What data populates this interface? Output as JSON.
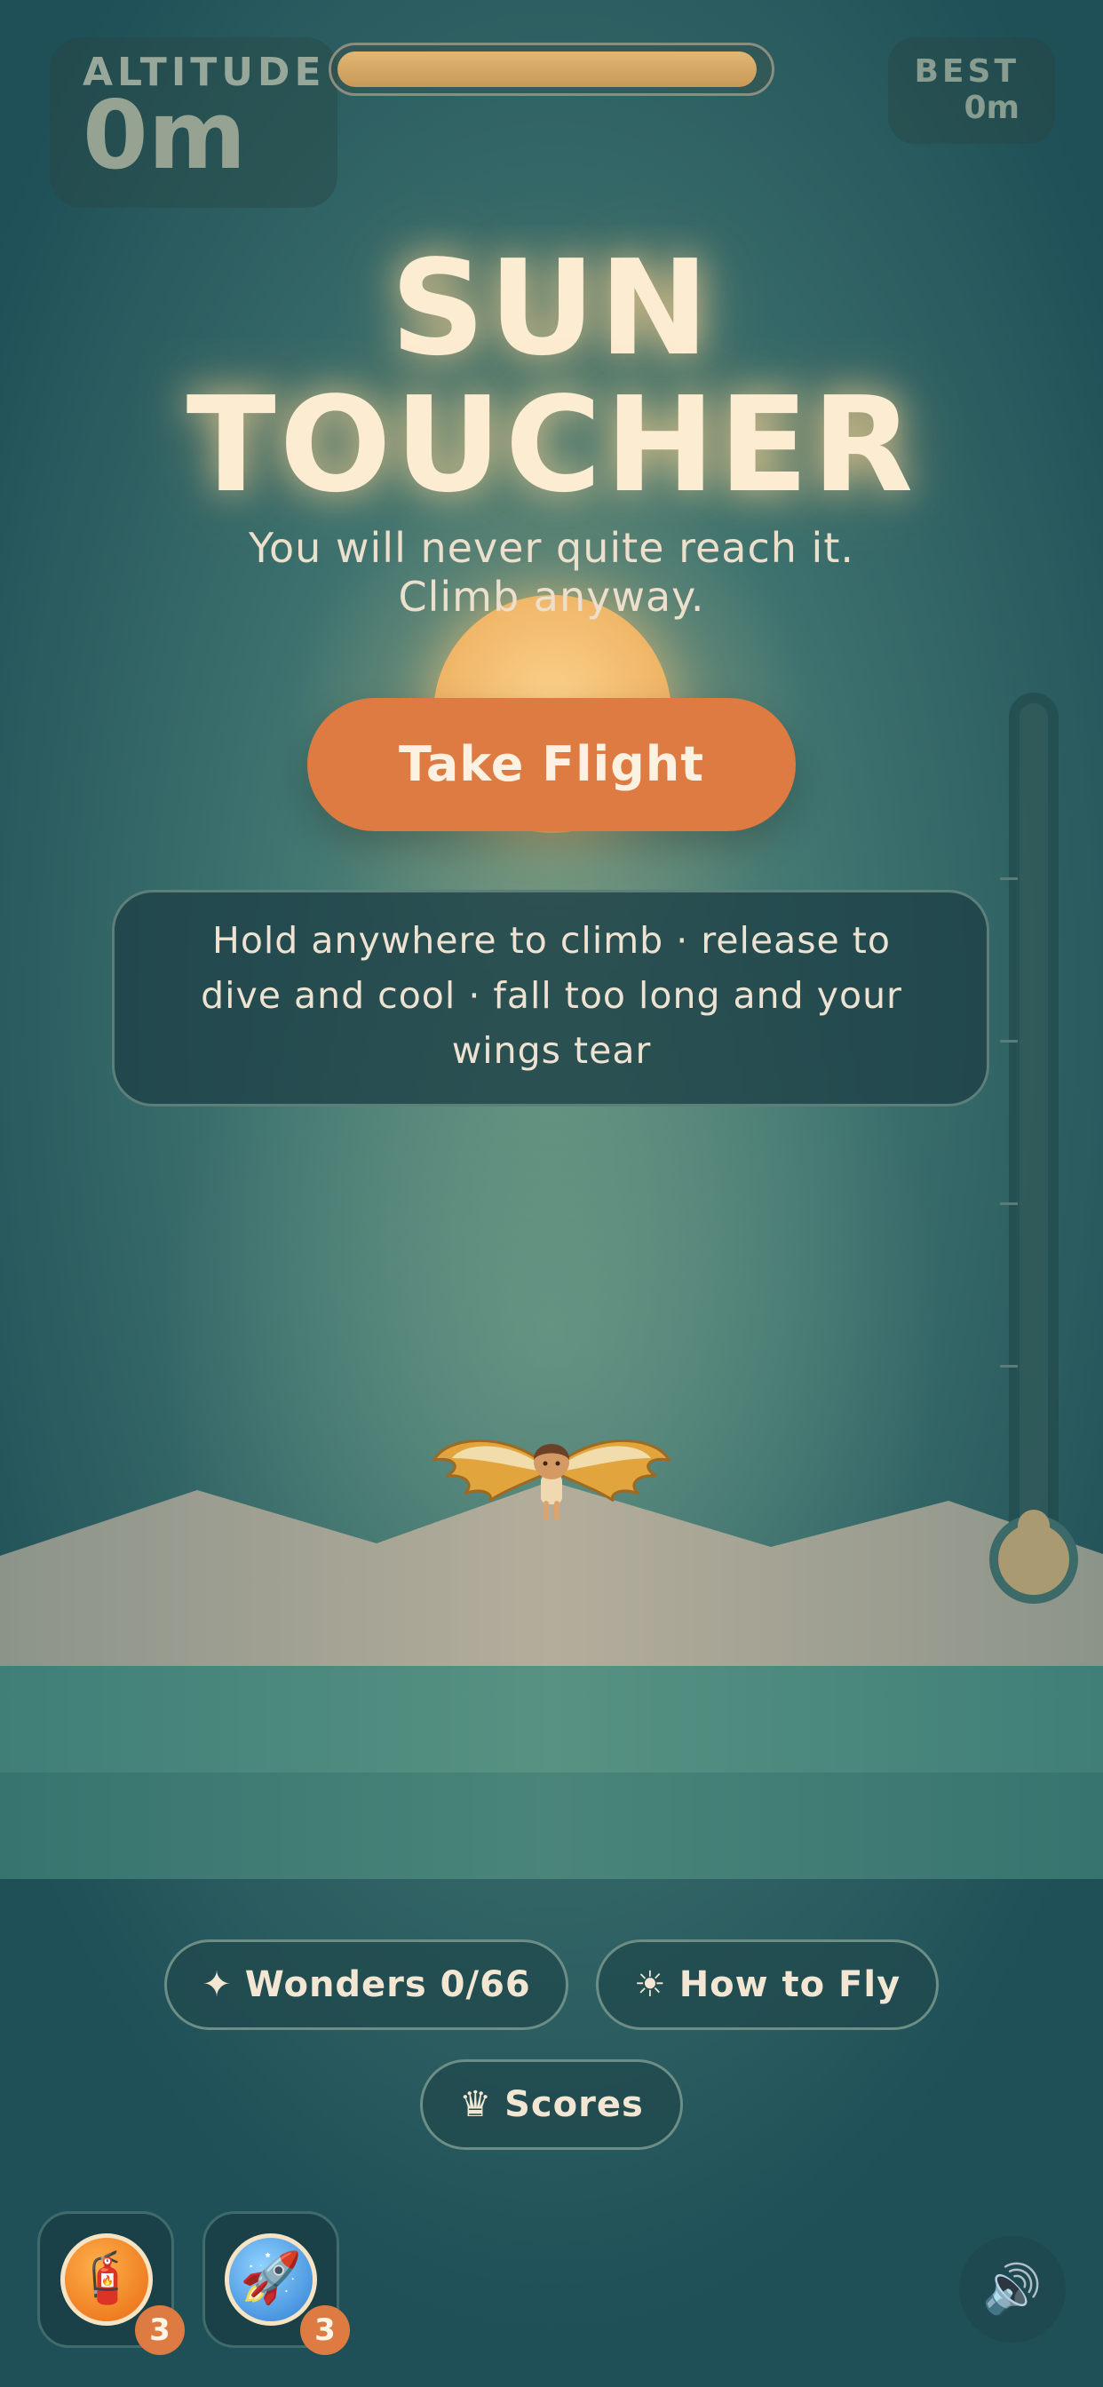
{
  "hud": {
    "altitude_label": "ALTITUDE",
    "altitude_value": "0m",
    "best_label": "BEST",
    "best_value": "0m",
    "progress_fraction": 0.98
  },
  "title": {
    "line1": "SUN",
    "line2": "TOUCHER",
    "subtitle_line1": "You will never quite reach it.",
    "subtitle_line2": "Climb anyway."
  },
  "start_button": {
    "label": "Take Flight"
  },
  "instructions": {
    "text": "Hold anywhere to climb · release to dive and cool · fall too long and your wings tear"
  },
  "menu": {
    "wonders": {
      "glyph": "✦",
      "label": "Wonders 0/66"
    },
    "how_to_fly": {
      "glyph": "☀",
      "label": "How to Fly"
    },
    "scores": {
      "glyph": "♛",
      "label": "Scores"
    }
  },
  "powerups": [
    {
      "icon": "fire-extinguisher-icon",
      "glyph": "🧯",
      "count": "3"
    },
    {
      "icon": "rocket-icon",
      "glyph": "🚀",
      "count": "3"
    }
  ],
  "sound": {
    "icon": "speaker-icon",
    "glyph": "🔊"
  },
  "thermometer": {
    "level": 0.0
  },
  "colors": {
    "accent_orange": "#dd7b42",
    "title_cream": "#fcecd2",
    "teal_background": "#3f7470",
    "sun_gold": "#f0b769"
  }
}
